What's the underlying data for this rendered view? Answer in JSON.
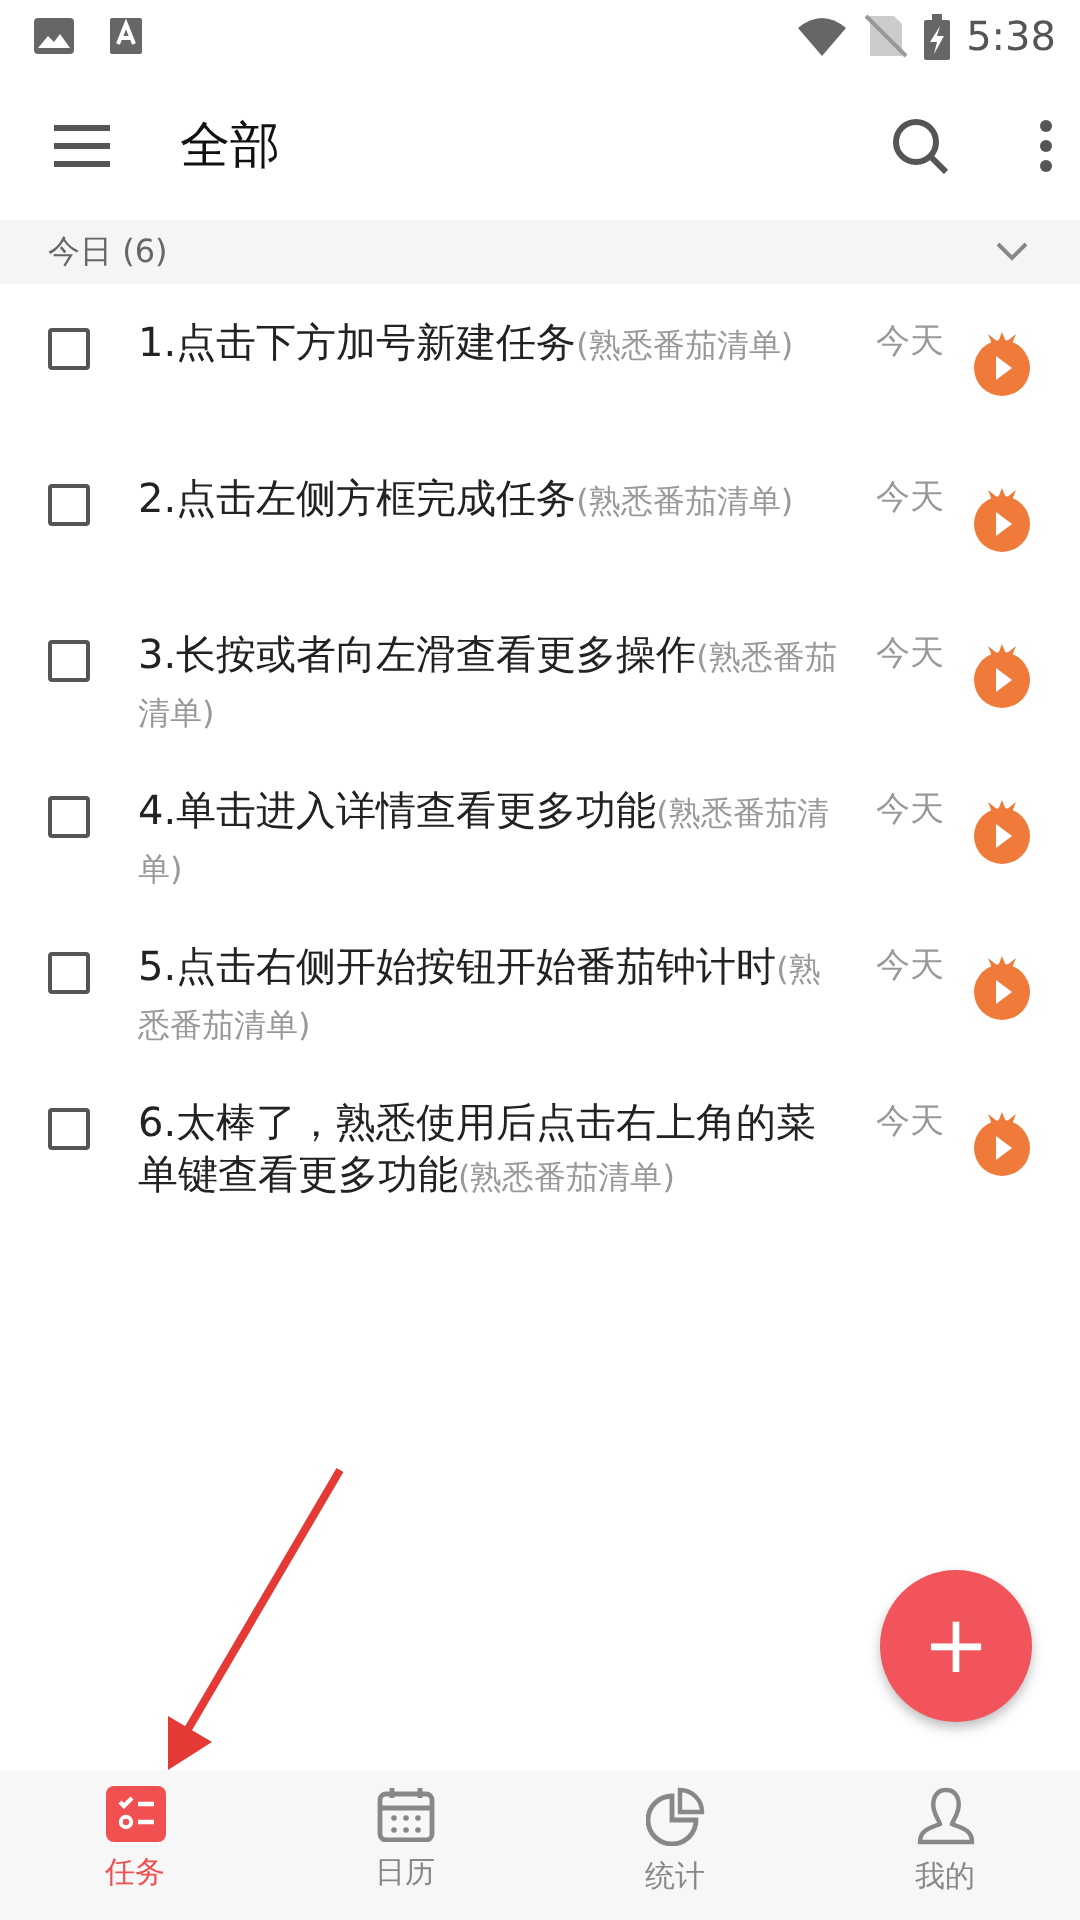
{
  "status_bar": {
    "time": "5:38"
  },
  "app_bar": {
    "title": "全部"
  },
  "section": {
    "label": "今日 (6)",
    "expanded": true
  },
  "tasks": [
    {
      "title": "1.点击下方加号新建任务",
      "list": "(熟悉番茄清单)",
      "date": "今天",
      "checked": false
    },
    {
      "title": "2.点击左侧方框完成任务",
      "list": "(熟悉番茄清单)",
      "date": "今天",
      "checked": false
    },
    {
      "title": "3.长按或者向左滑查看更多操作",
      "list": "(熟悉番茄清单)",
      "date": "今天",
      "checked": false
    },
    {
      "title": "4.单击进入详情查看更多功能",
      "list": "(熟悉番茄清单)",
      "date": "今天",
      "checked": false
    },
    {
      "title": "5.点击右侧开始按钮开始番茄钟计时",
      "list": "(熟悉番茄清单)",
      "date": "今天",
      "checked": false
    },
    {
      "title": "6.太棒了，熟悉使用后点击右上角的菜单键查看更多功能",
      "list": "(熟悉番茄清单)",
      "date": "今天",
      "checked": false
    }
  ],
  "fab": {
    "label": "+"
  },
  "bottom_nav": [
    {
      "kind": "tasks",
      "label": "任务",
      "selected": true
    },
    {
      "kind": "calendar",
      "label": "日历",
      "selected": false
    },
    {
      "kind": "stats",
      "label": "统计",
      "selected": false
    },
    {
      "kind": "profile",
      "label": "我的",
      "selected": false
    }
  ]
}
